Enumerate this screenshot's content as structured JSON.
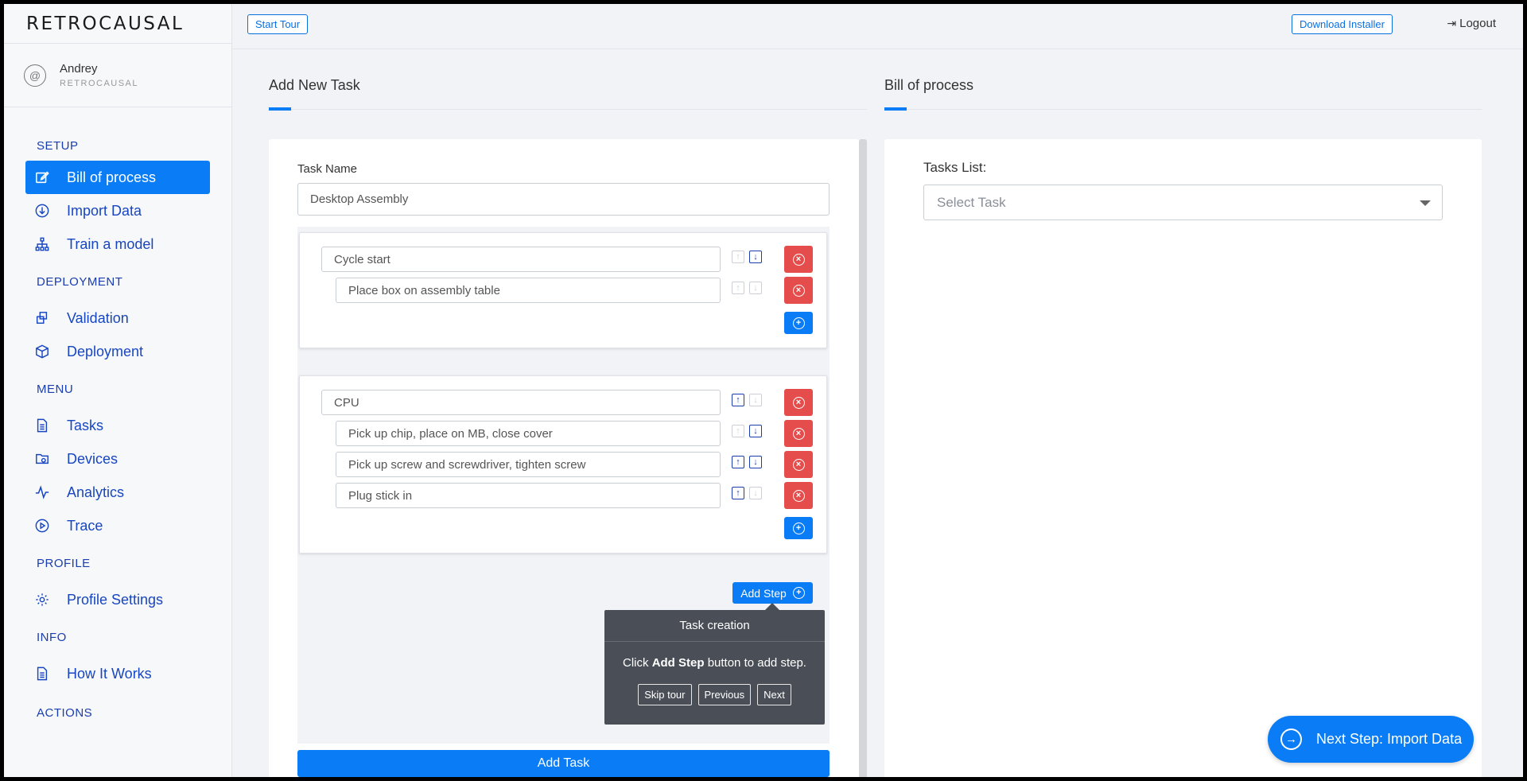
{
  "app": {
    "logo": "RETROCAUSAL"
  },
  "user": {
    "name": "Andrey",
    "org": "RETROCAUSAL"
  },
  "sidebar": {
    "sections": [
      {
        "title": "SETUP",
        "items": [
          {
            "label": "Bill of process",
            "icon": "edit-icon",
            "active": true
          },
          {
            "label": "Import Data",
            "icon": "download-circle-icon"
          },
          {
            "label": "Train a model",
            "icon": "hierarchy-icon"
          }
        ]
      },
      {
        "title": "DEPLOYMENT",
        "items": [
          {
            "label": "Validation",
            "icon": "copy-icon"
          },
          {
            "label": "Deployment",
            "icon": "cube-icon"
          }
        ]
      },
      {
        "title": "MENU",
        "items": [
          {
            "label": "Tasks",
            "icon": "document-icon"
          },
          {
            "label": "Devices",
            "icon": "folder-camera-icon"
          },
          {
            "label": "Analytics",
            "icon": "activity-icon"
          },
          {
            "label": "Trace",
            "icon": "play-circle-icon"
          }
        ]
      },
      {
        "title": "PROFILE",
        "items": [
          {
            "label": "Profile Settings",
            "icon": "gear-icon"
          }
        ]
      },
      {
        "title": "INFO",
        "items": [
          {
            "label": "How It Works",
            "icon": "document-icon"
          }
        ]
      },
      {
        "title": "ACTIONS",
        "items": []
      }
    ]
  },
  "topbar": {
    "start_tour": "Start Tour",
    "download_installer": "Download Installer",
    "logout": "Logout"
  },
  "left_col": {
    "title": "Add New Task",
    "task_name_label": "Task Name",
    "task_name_value": "Desktop Assembly",
    "groups": [
      {
        "header": "Cycle start",
        "steps": [
          "Place box on assembly table"
        ]
      },
      {
        "header": "CPU",
        "steps": [
          "Pick up chip, place on MB, close cover",
          "Pick up screw and screwdriver, tighten screw",
          "Plug stick in"
        ]
      }
    ],
    "add_step": "Add Step",
    "add_task": "Add Task"
  },
  "tooltip": {
    "title": "Task creation",
    "body_pre": "Click ",
    "body_bold": "Add Step",
    "body_post": " button to add step.",
    "skip": "Skip tour",
    "previous": "Previous",
    "next": "Next"
  },
  "right_col": {
    "title": "Bill of process",
    "tasks_list_label": "Tasks List:",
    "select_placeholder": "Select Task",
    "next_step": "Next Step: Import Data"
  },
  "colors": {
    "accent": "#0a7cf5",
    "danger": "#e54d4d",
    "nav_text": "#1846c0"
  }
}
